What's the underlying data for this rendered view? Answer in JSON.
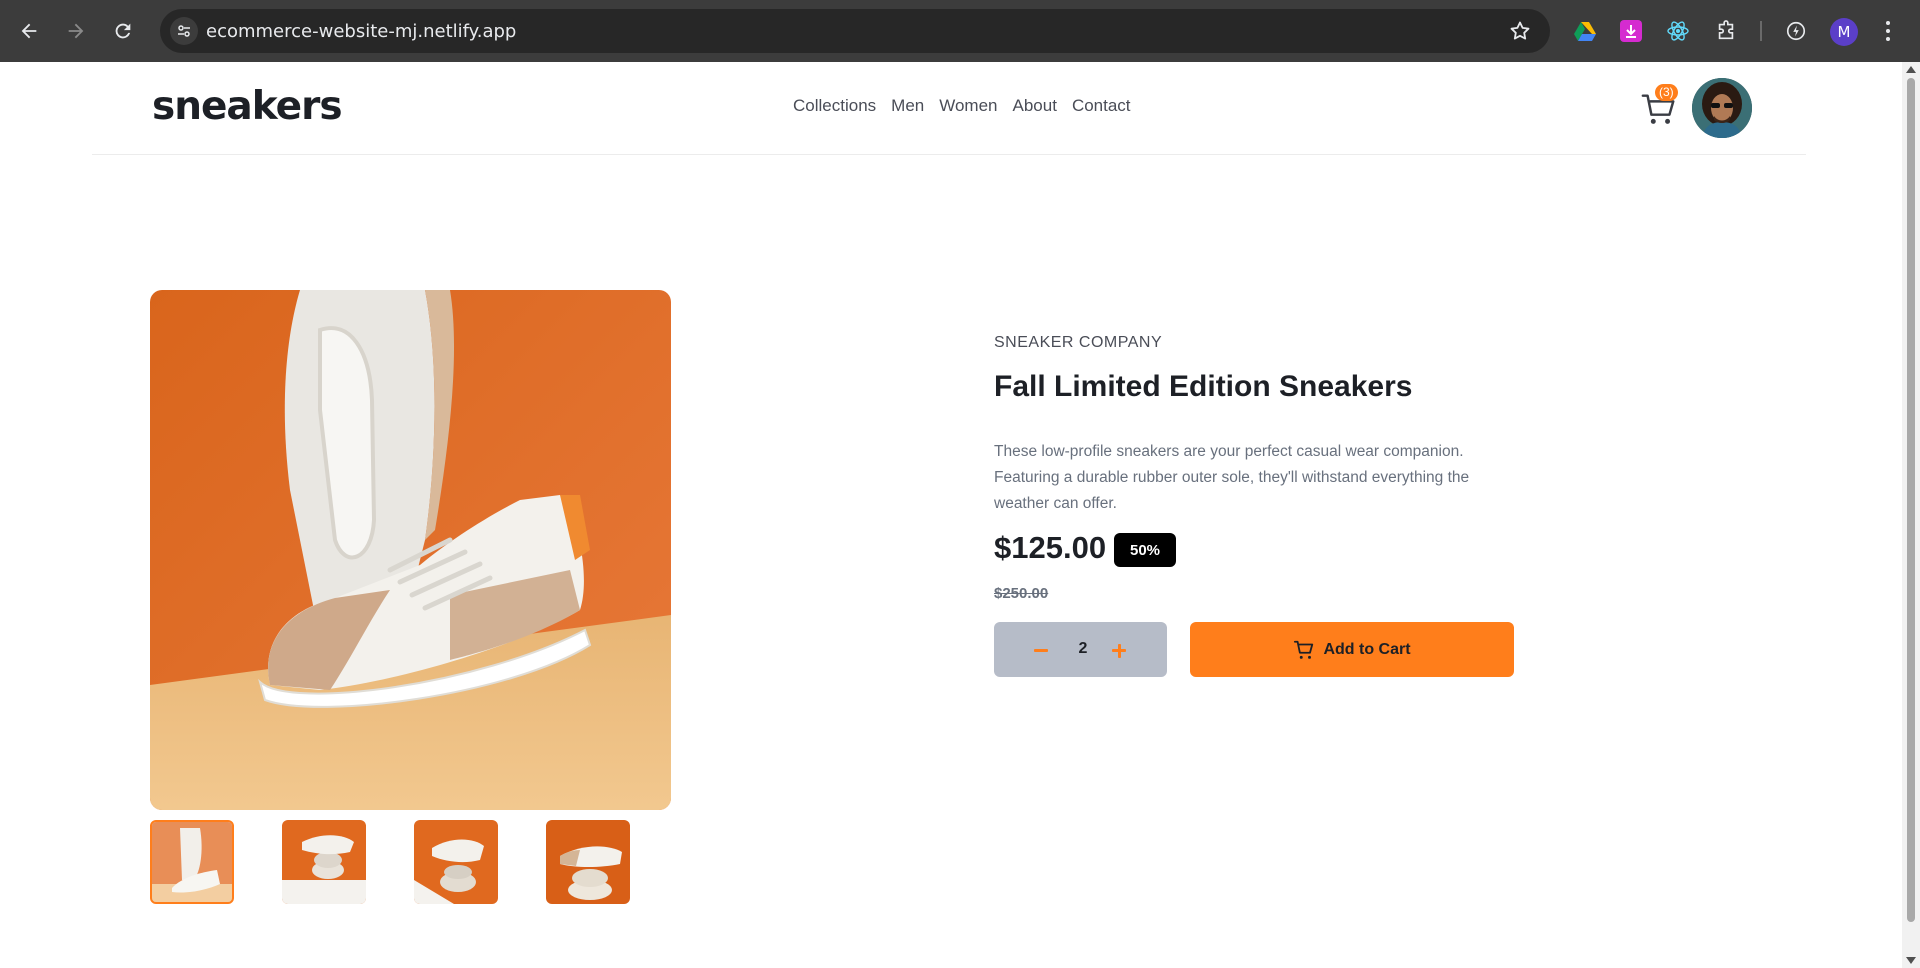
{
  "browser": {
    "url": "ecommerce-website-mj.netlify.app",
    "profile_initial": "M",
    "icons": [
      "back-arrow-icon",
      "forward-arrow-icon",
      "reload-icon",
      "site-settings-icon",
      "star-bookmark-icon",
      "google-drive-icon",
      "download-extension-icon",
      "react-devtools-icon",
      "extensions-puzzle-icon",
      "performance-icon",
      "more-menu-icon"
    ]
  },
  "header": {
    "logo": "sneakers",
    "nav": [
      "Collections",
      "Men",
      "Women",
      "About",
      "Contact"
    ],
    "cart_count": "(3)"
  },
  "product": {
    "company": "SNEAKER COMPANY",
    "title": "Fall Limited Edition Sneakers",
    "description": "These low-profile sneakers are your perfect casual wear companion. Featuring a durable rubber outer sole, they'll withstand everything the weather can offer.",
    "price": "$125.00",
    "discount": "50%",
    "original_price": "$250.00",
    "quantity": "2",
    "add_to_cart": "Add to Cart"
  },
  "gallery": {
    "thumbnail_count": 4,
    "active_thumbnail": 1
  },
  "colors": {
    "accent": "#ff7e1b",
    "dark": "#1d2026",
    "text_gray": "#68707d",
    "qty_bg": "#b6bcc8"
  }
}
